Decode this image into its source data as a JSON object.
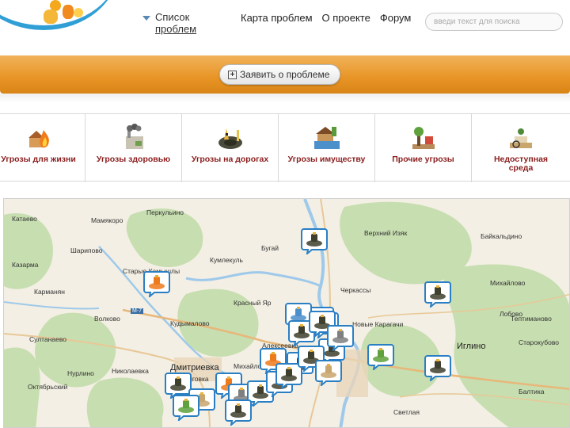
{
  "header": {
    "list_toggle_line1": "Список",
    "list_toggle_line2": "проблем",
    "nav": [
      "Карта проблем",
      "О проекте",
      "Форум"
    ],
    "search_placeholder": "введи текст для поиска"
  },
  "band": {
    "report_button": "Заявить о проблеме"
  },
  "categories": [
    {
      "label": "Угрозы для жизни",
      "icon": "fire-threat-icon"
    },
    {
      "label": "Угрозы здоровью",
      "icon": "smoke-factory-icon"
    },
    {
      "label": "Угрозы на дорогах",
      "icon": "road-pothole-icon"
    },
    {
      "label": "Угрозы имуществу",
      "icon": "flood-house-icon"
    },
    {
      "label": "Прочие угрозы",
      "icon": "tree-threat-icon"
    },
    {
      "label": "Недоступная\nсреда",
      "icon": "wheelchair-icon"
    }
  ],
  "map": {
    "places": [
      "Катаево",
      "Мамякоро",
      "Перкульино",
      "Шарипово",
      "Казарма",
      "Старые Камышлы",
      "Кумлекуль",
      "Бугай",
      "Карманян",
      "Красный Яр",
      "Волково",
      "Кудымалово",
      "Султанаево",
      "Нурлино",
      "Николаевка",
      "Октябрьский",
      "Дмитриевка",
      "Миговка",
      "Михайловка",
      "Алексеевка",
      "Черкассы",
      "Новые Карагачи",
      "Верхний Изяк",
      "Байкальдино",
      "Михайлово",
      "Лобово",
      "Тептиманово",
      "Иглино",
      "Старокубово",
      "Балтика",
      "Светлая",
      "М-7"
    ],
    "markers": [
      "road-marker",
      "fire-marker",
      "road-marker",
      "smoke-marker",
      "flood-marker",
      "smoke-marker",
      "road-marker",
      "road-marker",
      "fire-marker",
      "road-marker",
      "other-marker",
      "road-marker",
      "road-marker",
      "wheelchair-marker",
      "fire-marker",
      "smoke-marker",
      "road-marker",
      "road-marker",
      "road-marker",
      "other-marker",
      "road-marker",
      "smoke-marker",
      "road-marker",
      "road-marker",
      "wheelchair-marker"
    ]
  },
  "colors": {
    "band_orange": "#e89425",
    "category_text": "#8a1c1c",
    "marker_border": "#2a7fc4",
    "map_green": "#c7deb0",
    "map_land": "#f3efe4",
    "river": "#9ec9ea"
  }
}
